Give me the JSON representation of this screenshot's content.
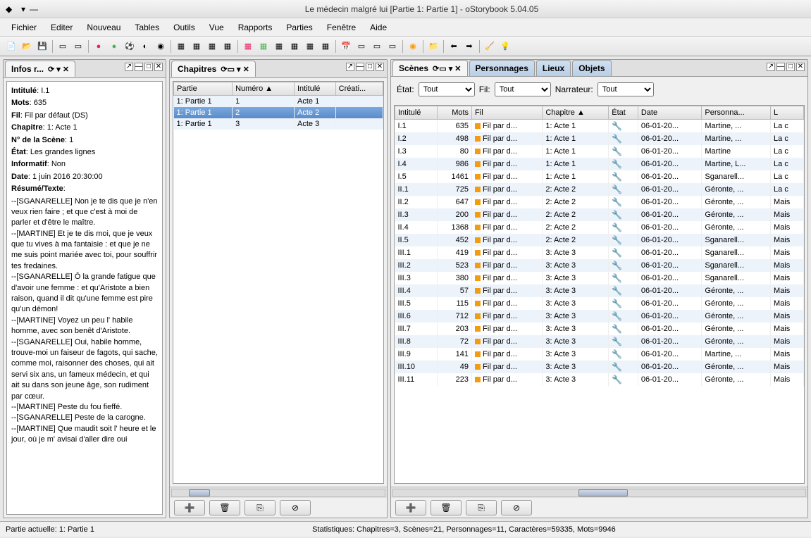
{
  "window": {
    "title": "Le médecin malgré lui [Partie 1: Partie 1] - oStorybook 5.04.05"
  },
  "menu": {
    "fichier": "Fichier",
    "editer": "Editer",
    "nouveau": "Nouveau",
    "tables": "Tables",
    "outils": "Outils",
    "vue": "Vue",
    "rapports": "Rapports",
    "parties": "Parties",
    "fenetre": "Fenêtre",
    "aide": "Aide"
  },
  "infos": {
    "title": "Infos r...",
    "lbl_intitule": "Intitulé",
    "intitule": "I.1",
    "lbl_mots": "Mots",
    "mots": "635",
    "lbl_fil": "Fil",
    "fil": "Fil par défaut (DS)",
    "lbl_chapitre": "Chapitre",
    "chapitre": "1: Acte 1",
    "lbl_numscene": "N° de la Scène",
    "numscene": "1",
    "lbl_etat": "État",
    "etat": "Les grandes lignes",
    "lbl_informatif": "Informatif",
    "informatif": "Non",
    "lbl_date": "Date",
    "date": "1 juin 2016 20:30:00",
    "lbl_resume": "Résumé/Texte",
    "text": "--[SGANARELLE] Non je te dis que je n'en veux rien faire ; et que c'est à moi de parler et d'être le maître.\n--[MARTINE] Et je te dis moi, que je veux que tu vives à ma fantaisie : et que je ne me suis point mariée avec toi, pour souffrir tes fredaines.\n--[SGANARELLE] Ô la grande fatigue que d'avoir une femme : et qu'Aristote a bien raison, quand il dit qu'une femme est pire qu'un démon!\n--[MARTINE] Voyez un peu l' habile homme, avec son benêt d'Aristote.\n--[SGANARELLE] Oui, habile homme, trouve-moi un faiseur de fagots, qui sache, comme moi, raisonner des choses, qui ait servi six ans, un fameux médecin, et qui ait su dans son jeune âge, son rudiment par cœur.\n--[MARTINE] Peste du fou fieffé.\n--[SGANARELLE] Peste de la carogne.\n--[MARTINE] Que maudit soit l' heure et le jour, où je m' avisai d'aller dire oui"
  },
  "chapitres": {
    "title": "Chapitres",
    "cols": {
      "partie": "Partie",
      "numero": "Numéro",
      "intitule": "Intitulé",
      "creation": "Créati..."
    },
    "rows": [
      {
        "partie": "1: Partie 1",
        "numero": "1",
        "intitule": "Acte 1"
      },
      {
        "partie": "1: Partie 1",
        "numero": "2",
        "intitule": "Acte 2"
      },
      {
        "partie": "1: Partie 1",
        "numero": "3",
        "intitule": "Acte 3"
      }
    ]
  },
  "scenes": {
    "tabs": {
      "scenes": "Scènes",
      "personnages": "Personnages",
      "lieux": "Lieux",
      "objets": "Objets"
    },
    "filters": {
      "lbl_etat": "État:",
      "etat_val": "Tout",
      "lbl_fil": "Fil:",
      "fil_val": "Tout",
      "lbl_narr": "Narrateur:",
      "narr_val": "Tout"
    },
    "cols": {
      "intitule": "Intitulé",
      "mots": "Mots",
      "fil": "Fil",
      "chapitre": "Chapitre",
      "etat": "État",
      "date": "Date",
      "personna": "Personna...",
      "l": "L"
    },
    "fil_txt": "Fil par d...",
    "rows": [
      {
        "intitule": "I.1",
        "mots": "635",
        "ch": "1: Acte 1",
        "date": "06-01-20...",
        "pers": "Martine, ...",
        "l": "La c"
      },
      {
        "intitule": "I.2",
        "mots": "498",
        "ch": "1: Acte 1",
        "date": "06-01-20...",
        "pers": "Martine, ...",
        "l": "La c"
      },
      {
        "intitule": "I.3",
        "mots": "80",
        "ch": "1: Acte 1",
        "date": "06-01-20...",
        "pers": "Martine",
        "l": "La c"
      },
      {
        "intitule": "I.4",
        "mots": "986",
        "ch": "1: Acte 1",
        "date": "06-01-20...",
        "pers": "Martine, L...",
        "l": "La c"
      },
      {
        "intitule": "I.5",
        "mots": "1461",
        "ch": "1: Acte 1",
        "date": "06-01-20...",
        "pers": "Sganarell...",
        "l": "La c"
      },
      {
        "intitule": "II.1",
        "mots": "725",
        "ch": "2: Acte 2",
        "date": "06-01-20...",
        "pers": "Géronte, ...",
        "l": "La c"
      },
      {
        "intitule": "II.2",
        "mots": "647",
        "ch": "2: Acte 2",
        "date": "06-01-20...",
        "pers": "Géronte, ...",
        "l": "Mais"
      },
      {
        "intitule": "II.3",
        "mots": "200",
        "ch": "2: Acte 2",
        "date": "06-01-20...",
        "pers": "Géronte, ...",
        "l": "Mais"
      },
      {
        "intitule": "II.4",
        "mots": "1368",
        "ch": "2: Acte 2",
        "date": "06-01-20...",
        "pers": "Géronte, ...",
        "l": "Mais"
      },
      {
        "intitule": "II.5",
        "mots": "452",
        "ch": "2: Acte 2",
        "date": "06-01-20...",
        "pers": "Sganarell...",
        "l": "Mais"
      },
      {
        "intitule": "III.1",
        "mots": "419",
        "ch": "3: Acte 3",
        "date": "06-01-20...",
        "pers": "Sganarell...",
        "l": "Mais"
      },
      {
        "intitule": "III.2",
        "mots": "523",
        "ch": "3: Acte 3",
        "date": "06-01-20...",
        "pers": "Sganarell...",
        "l": "Mais"
      },
      {
        "intitule": "III.3",
        "mots": "380",
        "ch": "3: Acte 3",
        "date": "06-01-20...",
        "pers": "Sganarell...",
        "l": "Mais"
      },
      {
        "intitule": "III.4",
        "mots": "57",
        "ch": "3: Acte 3",
        "date": "06-01-20...",
        "pers": "Géronte, ...",
        "l": "Mais"
      },
      {
        "intitule": "III.5",
        "mots": "115",
        "ch": "3: Acte 3",
        "date": "06-01-20...",
        "pers": "Géronte, ...",
        "l": "Mais"
      },
      {
        "intitule": "III.6",
        "mots": "712",
        "ch": "3: Acte 3",
        "date": "06-01-20...",
        "pers": "Géronte, ...",
        "l": "Mais"
      },
      {
        "intitule": "III.7",
        "mots": "203",
        "ch": "3: Acte 3",
        "date": "06-01-20...",
        "pers": "Géronte, ...",
        "l": "Mais"
      },
      {
        "intitule": "III.8",
        "mots": "72",
        "ch": "3: Acte 3",
        "date": "06-01-20...",
        "pers": "Géronte, ...",
        "l": "Mais"
      },
      {
        "intitule": "III.9",
        "mots": "141",
        "ch": "3: Acte 3",
        "date": "06-01-20...",
        "pers": "Martine, ...",
        "l": "Mais"
      },
      {
        "intitule": "III.10",
        "mots": "49",
        "ch": "3: Acte 3",
        "date": "06-01-20...",
        "pers": "Géronte, ...",
        "l": "Mais"
      },
      {
        "intitule": "III.11",
        "mots": "223",
        "ch": "3: Acte 3",
        "date": "06-01-20...",
        "pers": "Géronte, ...",
        "l": "Mais"
      }
    ]
  },
  "status": {
    "partie": "Partie actuelle: 1: Partie 1",
    "stats": "Statistiques: Chapitres=3,  Scènes=21,  Personnages=11,  Caractères=59335,  Mots=9946"
  }
}
